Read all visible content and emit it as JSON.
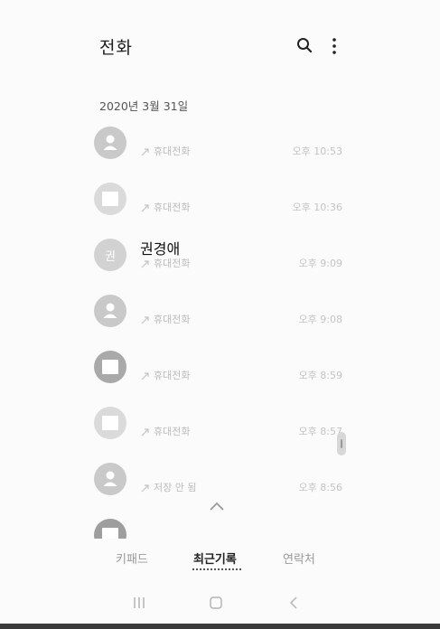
{
  "header": {
    "title": "전화",
    "search_icon": "search-icon",
    "more_icon": "more-vert-icon"
  },
  "date_header": "2020년 3월 31일",
  "calls": [
    {
      "name": "",
      "type": "휴대전화",
      "time": "오후 10:53",
      "avatar": "person"
    },
    {
      "name": "",
      "type": "휴대전화",
      "time": "오후 10:36",
      "avatar": "square"
    },
    {
      "name": "권경애",
      "type": "휴대전화",
      "time": "오후 9:09",
      "avatar": "initial",
      "initial": "권"
    },
    {
      "name": "",
      "type": "휴대전화",
      "time": "오후 9:08",
      "avatar": "person"
    },
    {
      "name": "",
      "type": "휴대전화",
      "time": "오후 8:59",
      "avatar": "square"
    },
    {
      "name": "",
      "type": "휴대전화",
      "time": "오후 8:57",
      "avatar": "square"
    },
    {
      "name": "",
      "type": "저장 안 됨",
      "time": "오후 8:56",
      "avatar": "person"
    }
  ],
  "tabs": [
    {
      "label": "키패드",
      "active": false
    },
    {
      "label": "최근기록",
      "active": true
    },
    {
      "label": "연락처",
      "active": false
    }
  ],
  "colors": {
    "avatar_gray": "#cfcfcf",
    "avatar_dark": "#a8a8a8",
    "text_light": "#bcbcbc"
  }
}
